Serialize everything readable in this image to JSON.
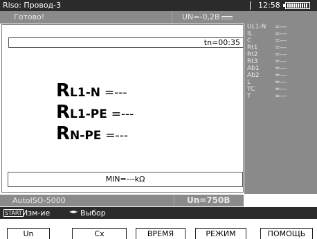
{
  "titlebar": {
    "title": "Riso: Провод-3",
    "time": "12:58"
  },
  "status": {
    "state": "Готово!",
    "voltage": "UN=-0,2В"
  },
  "main": {
    "timer": "tn=00:35",
    "results": [
      {
        "sym": "R",
        "sub": "L1-N",
        "value": "=---"
      },
      {
        "sym": "R",
        "sub": "L1-PE",
        "value": "=---"
      },
      {
        "sym": "R",
        "sub": "N-PE",
        "value": "=---"
      }
    ],
    "min": "MIN=---kΩ"
  },
  "side": {
    "rows": [
      {
        "label": "UL1-N",
        "value": "=---"
      },
      {
        "label": "IL",
        "value": "=---"
      },
      {
        "label": "C",
        "value": "=---"
      },
      {
        "label": "Rt1",
        "value": "=---"
      },
      {
        "label": "Rt2",
        "value": "=---"
      },
      {
        "label": "Rt3",
        "value": "=---"
      },
      {
        "label": "Ab1",
        "value": "=---"
      },
      {
        "label": "Ab2",
        "value": "=---"
      },
      {
        "label": "L",
        "value": "=---"
      },
      {
        "label": "TC",
        "value": "=---"
      },
      {
        "label": "T",
        "value": "=---"
      }
    ]
  },
  "mode": {
    "name": "AutoISO-5000",
    "un": "Un=750В"
  },
  "hint": {
    "start": "START",
    "change": "Изм-ие",
    "arrows": "◄►",
    "select": "Выбор"
  },
  "softkeys": [
    "Un",
    "Cx",
    "ВРЕМЯ",
    "РЕЖИМ",
    "ПОМОЩЬ"
  ]
}
